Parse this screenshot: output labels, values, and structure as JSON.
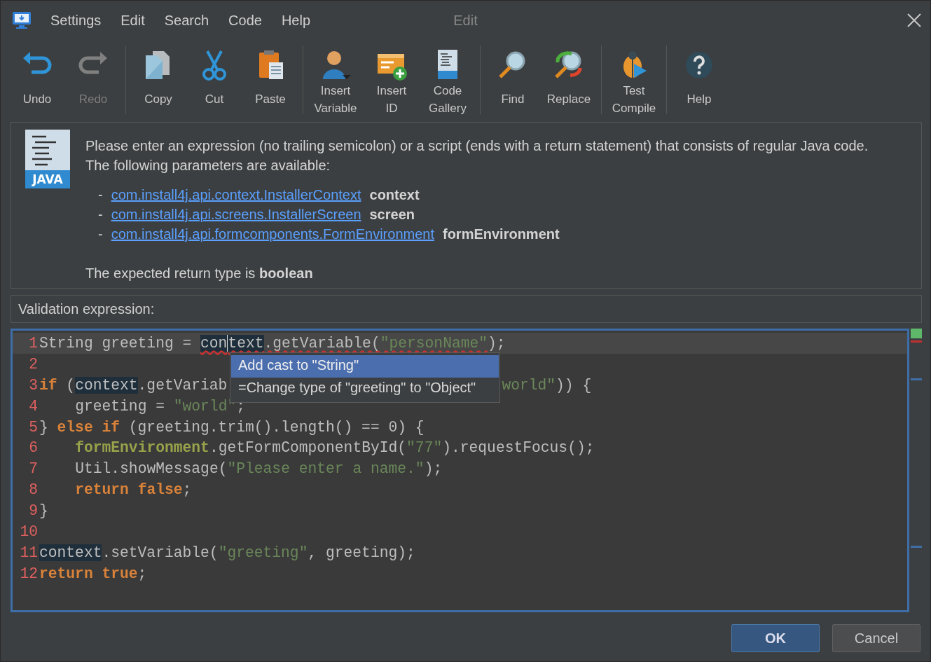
{
  "window": {
    "title": "Edit"
  },
  "menu": [
    {
      "label": "Settings"
    },
    {
      "label": "Edit"
    },
    {
      "label": "Search"
    },
    {
      "label": "Code"
    },
    {
      "label": "Help"
    }
  ],
  "toolbar": [
    [
      {
        "kind": "undo",
        "label": [
          "Undo"
        ],
        "disabled": false
      },
      {
        "kind": "redo",
        "label": [
          "Redo"
        ],
        "disabled": true
      }
    ],
    [
      {
        "kind": "copy",
        "label": [
          "Copy"
        ],
        "disabled": false
      },
      {
        "kind": "cut",
        "label": [
          "Cut"
        ],
        "disabled": false
      },
      {
        "kind": "paste",
        "label": [
          "Paste"
        ],
        "disabled": false
      }
    ],
    [
      {
        "kind": "variable",
        "label": [
          "Insert",
          "Variable"
        ],
        "disabled": false
      },
      {
        "kind": "id",
        "label": [
          "Insert",
          "ID"
        ],
        "disabled": false
      },
      {
        "kind": "gallery",
        "label": [
          "Code",
          "Gallery"
        ],
        "disabled": false
      }
    ],
    [
      {
        "kind": "find",
        "label": [
          "Find"
        ],
        "disabled": false
      },
      {
        "kind": "replace",
        "label": [
          "Replace"
        ],
        "disabled": false
      }
    ],
    [
      {
        "kind": "compile",
        "label": [
          "Test",
          "Compile"
        ],
        "disabled": false
      }
    ],
    [
      {
        "kind": "help",
        "label": [
          "Help"
        ],
        "disabled": false
      }
    ]
  ],
  "info": {
    "badge": "JAVA",
    "intro": "Please enter an expression (no trailing semicolon) or a script (ends with a return statement) that consists of regular Java code. The following parameters are available:",
    "parameters": [
      {
        "prefix": "-",
        "type": "com.install4j.api.context.InstallerContext",
        "name": "context"
      },
      {
        "prefix": "-",
        "type": "com.install4j.api.screens.InstallerScreen",
        "name": "screen"
      },
      {
        "prefix": "-",
        "type": "com.install4j.api.formcomponents.FormEnvironment",
        "name": "formEnvironment"
      }
    ],
    "return_note": "The expected return type is **boolean**"
  },
  "expression_label": "Validation expression:",
  "editor": {
    "analysis_ok": true,
    "lines": [
      {
        "number": "1",
        "current": true,
        "marker": {
          "kind": "error"
        },
        "tokens": [
          {
            "text": "String greeting = ",
            "kind": "plain",
            "error": false,
            "caret": false
          },
          {
            "text": "con",
            "kind": "highlight",
            "error": true,
            "caret": true
          },
          {
            "text": "text",
            "kind": "highlight",
            "error": true,
            "caret": false
          },
          {
            "text": ".getVariable(",
            "kind": "plain",
            "error": true,
            "caret": false
          },
          {
            "text": "\"personName\"",
            "kind": "string",
            "error": true,
            "caret": false
          },
          {
            "text": ");",
            "kind": "plain",
            "error": false,
            "caret": false
          }
        ]
      },
      {
        "number": "2",
        "current": false
      },
      {
        "number": "3",
        "current": false,
        "marker": {
          "kind": "occurrence"
        },
        "tokens": [
          {
            "text": "if",
            "kind": "keyword"
          },
          {
            "text": " (",
            "kind": "plain"
          },
          {
            "text": "context",
            "kind": "highlight"
          },
          {
            "text": ".getVariab",
            "kind": "plain"
          }
        ],
        "tail": [
          {
            "text": "world\"",
            "kind": "string"
          },
          {
            "text": ")) {",
            "kind": "plain"
          }
        ]
      },
      {
        "number": "4",
        "current": false,
        "indent": true,
        "tokens": [
          {
            "text": "greeting = ",
            "kind": "plain"
          },
          {
            "text": "\"world\"",
            "kind": "string"
          },
          {
            "text": ";",
            "kind": "plain"
          }
        ]
      },
      {
        "number": "5",
        "current": false,
        "tokens": [
          {
            "text": "} ",
            "kind": "plain"
          },
          {
            "text": "else if",
            "kind": "keyword"
          },
          {
            "text": " (greeting.trim().length() == 0) {",
            "kind": "plain"
          }
        ]
      },
      {
        "number": "6",
        "current": false,
        "indent": true,
        "tokens": [
          {
            "text": "formEnvironment",
            "kind": "field"
          },
          {
            "text": ".getFormComponentById(",
            "kind": "plain"
          },
          {
            "text": "\"77\"",
            "kind": "string"
          },
          {
            "text": ").requestFocus();",
            "kind": "plain"
          }
        ]
      },
      {
        "number": "7",
        "current": false,
        "indent": true,
        "tokens": [
          {
            "text": "Util.showMessage(",
            "kind": "plain"
          },
          {
            "text": "\"Please enter a name.\"",
            "kind": "string"
          },
          {
            "text": ");",
            "kind": "plain"
          }
        ]
      },
      {
        "number": "8",
        "current": false,
        "indent": true,
        "tokens": [
          {
            "text": "return false",
            "kind": "keyword"
          },
          {
            "text": ";",
            "kind": "plain"
          }
        ]
      },
      {
        "number": "9",
        "current": false,
        "tokens": [
          {
            "text": "}",
            "kind": "plain"
          }
        ]
      },
      {
        "number": "10",
        "current": false
      },
      {
        "number": "11",
        "current": false,
        "marker": {
          "kind": "occurrence"
        },
        "tokens": [
          {
            "text": "context",
            "kind": "highlight"
          },
          {
            "text": ".setVariable(",
            "kind": "plain"
          },
          {
            "text": "\"greeting\"",
            "kind": "string"
          },
          {
            "text": ", greeting);",
            "kind": "plain"
          }
        ]
      },
      {
        "number": "12",
        "current": false,
        "tokens": [
          {
            "text": "return true",
            "kind": "keyword"
          },
          {
            "text": ";",
            "kind": "plain"
          }
        ]
      }
    ],
    "suggestions": [
      {
        "label": "Add cast to \"String\"",
        "selected": true
      },
      {
        "label": "=Change type of \"greeting\" to \"Object\"",
        "selected": false
      }
    ]
  },
  "buttons": [
    {
      "label": "OK",
      "default": true
    },
    {
      "label": "Cancel",
      "default": false
    }
  ]
}
